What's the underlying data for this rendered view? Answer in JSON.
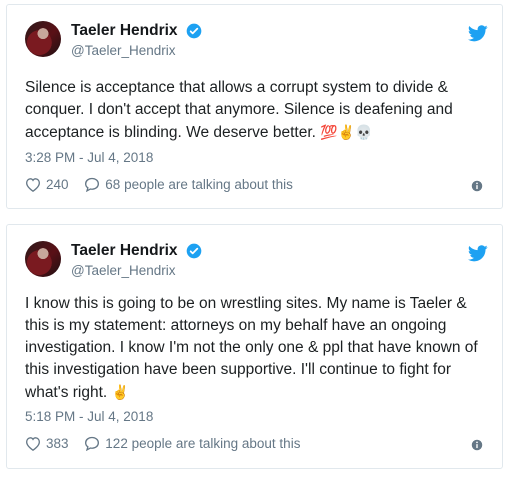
{
  "tweets": [
    {
      "author": "Taeler Hendrix",
      "handle": "@Taeler_Hendrix",
      "text": "Silence is acceptance that allows a corrupt system to divide & conquer. I don't accept that anymore. Silence is deafening and acceptance is blinding. We deserve better.",
      "emojis": "💯✌💀",
      "time": "3:28 PM - Jul 4, 2018",
      "likes": "240",
      "talking": "68 people are talking about this"
    },
    {
      "author": "Taeler Hendrix",
      "handle": "@Taeler_Hendrix",
      "text": "I know this is going to be on wrestling sites. My name is Taeler & this is my statement: attorneys on my behalf have an ongoing investigation. I know I'm not the only one & ppl that have known of this investigation have been supportive. I'll continue to fight for what's right.",
      "emojis": "✌",
      "time": "5:18 PM - Jul 4, 2018",
      "likes": "383",
      "talking": "122 people are talking about this"
    }
  ],
  "colors": {
    "twitter_blue": "#1da1f2",
    "meta_gray": "#657786"
  },
  "icons": [
    "verified-badge-icon",
    "twitter-bird-icon",
    "heart-icon",
    "comment-icon",
    "info-icon"
  ]
}
